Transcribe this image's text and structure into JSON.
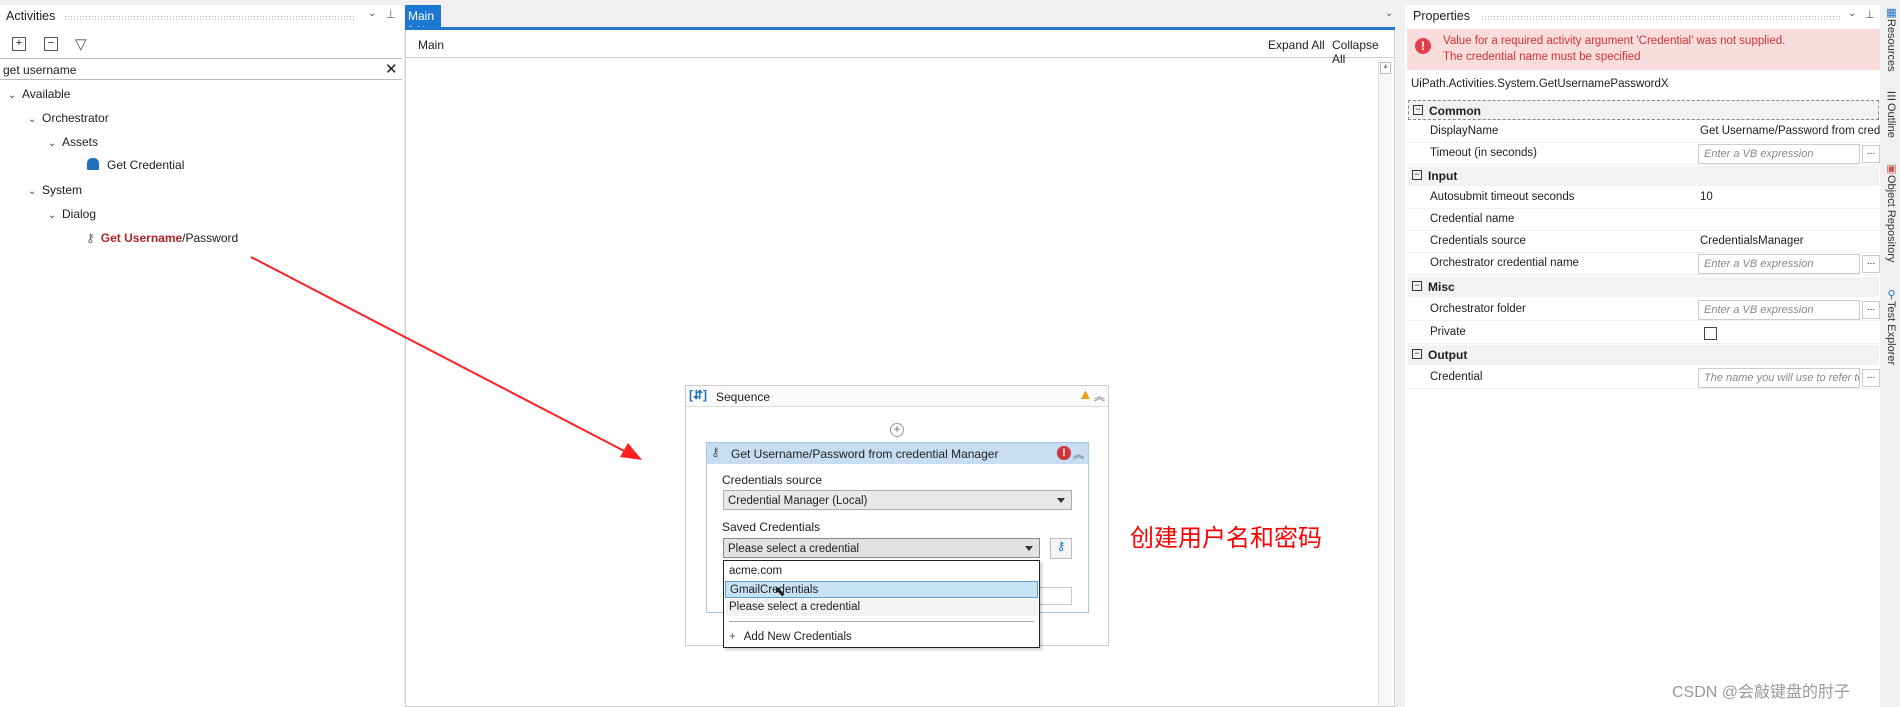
{
  "activities": {
    "title": "Activities",
    "search_value": "get username",
    "tree": [
      {
        "label": "Available"
      },
      {
        "label": "Orchestrator"
      },
      {
        "label": "Assets"
      },
      {
        "label": "Get Credential",
        "icon": "lock-icon"
      },
      {
        "label": "System"
      },
      {
        "label": "Dialog"
      },
      {
        "label_match": "Get Username",
        "label_rest": "/Password",
        "icon": "key-icon"
      }
    ]
  },
  "designer": {
    "tab_label": "Main *",
    "breadcrumb": "Main",
    "expand_all": "Expand All",
    "collapse_all": "Collapse All",
    "sequence": {
      "title": "Sequence",
      "activity": {
        "title": "Get Username/Password from credential Manager",
        "credentials_source_label": "Credentials source",
        "credentials_source_value": "Credential Manager (Local)",
        "saved_credentials_label": "Saved Credentials",
        "saved_credentials_value": "Please select a credential",
        "dropdown_options": [
          "acme.com",
          "GmailCredentials",
          "Please select a credential"
        ],
        "highlighted_option": "GmailCredentials",
        "add_new": "Add New Credentials"
      }
    }
  },
  "properties": {
    "title": "Properties",
    "error_line1": "Value for a required activity argument 'Credential' was not supplied.",
    "error_line2": "The credential name must be specified",
    "type_name": "UiPath.Activities.System.GetUsernamePasswordX",
    "categories": {
      "common": "Common",
      "input": "Input",
      "misc": "Misc",
      "output": "Output"
    },
    "rows": {
      "display_name": {
        "label": "DisplayName",
        "value": "Get Username/Password from credential Manager"
      },
      "timeout": {
        "label": "Timeout (in seconds)",
        "placeholder": "Enter a VB expression"
      },
      "autosubmit": {
        "label": "Autosubmit timeout seconds",
        "value": "10"
      },
      "credential_name": {
        "label": "Credential name",
        "value": ""
      },
      "credentials_source": {
        "label": "Credentials source",
        "value": "CredentialsManager"
      },
      "orch_cred_name": {
        "label": "Orchestrator credential name",
        "placeholder": "Enter a VB expression"
      },
      "orch_folder": {
        "label": "Orchestrator folder",
        "placeholder": "Enter a VB expression"
      },
      "private": {
        "label": "Private",
        "checked": false
      },
      "credential": {
        "label": "Credential",
        "placeholder": "The name you will use to refer to the credential"
      }
    },
    "ellipsis": "..."
  },
  "side_tabs": [
    "Resources",
    "Outline",
    "Object Repository",
    "Test Explorer"
  ],
  "annotation": {
    "text": "创建用户名和密码",
    "color": "#ff0000"
  },
  "watermark": "CSDN @会敲键盘的肘子",
  "colors": {
    "accent": "#1e78d2",
    "error_bg": "#f9dcdc",
    "error_text": "#d13438",
    "activity_header": "#c7ddf1"
  }
}
